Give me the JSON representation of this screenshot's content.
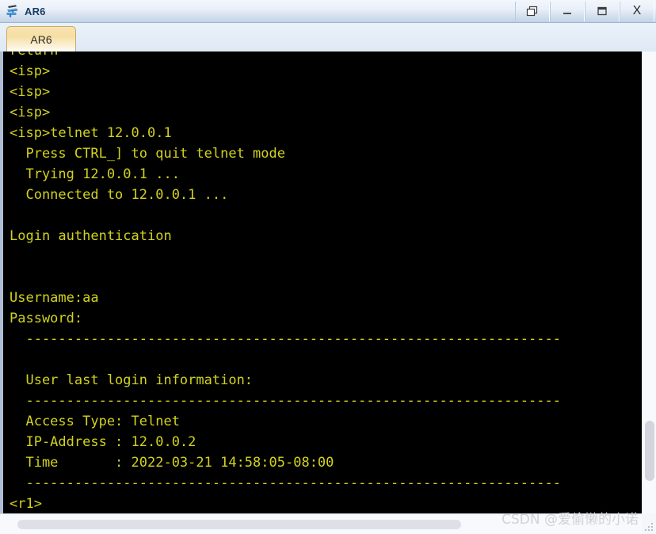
{
  "window": {
    "title": "AR6",
    "icon": "router-device-icon",
    "controls": [
      {
        "name": "restore-down-button",
        "glyph": "restore"
      },
      {
        "name": "minimize-button",
        "glyph": "minimize"
      },
      {
        "name": "maximize-button",
        "glyph": "maximize"
      },
      {
        "name": "close-button",
        "glyph": "X"
      }
    ]
  },
  "tabs": [
    {
      "label": "AR6",
      "active": true
    }
  ],
  "terminal": {
    "foreground_color": "#d2d21e",
    "background_color": "#000000",
    "lines": [
      "return",
      "<isp>",
      "<isp>",
      "<isp>",
      "<isp>telnet 12.0.0.1",
      "  Press CTRL_] to quit telnet mode",
      "  Trying 12.0.0.1 ...",
      "  Connected to 12.0.0.1 ...",
      "",
      "Login authentication",
      "",
      "",
      "Username:aa",
      "Password:",
      "  ------------------------------------------------------------------",
      "",
      "  User last login information:",
      "  ------------------------------------------------------------------",
      "  Access Type: Telnet",
      "  IP-Address : 12.0.0.2",
      "  Time       : 2022-03-21 14:58:05-08:00",
      "  ------------------------------------------------------------------",
      "<r1>"
    ]
  },
  "scrollbars": {
    "vertical": {
      "name": "vertical-scrollbar"
    },
    "horizontal": {
      "name": "horizontal-scrollbar"
    }
  },
  "watermark": {
    "text": "CSDN @爱偷懒的小诺"
  }
}
